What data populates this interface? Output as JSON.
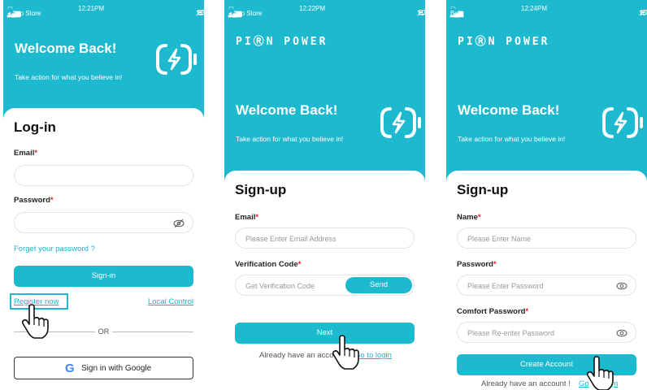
{
  "accent_color": "#1cb9cf",
  "screens": [
    {
      "status": {
        "left": "◂ App Store",
        "time": "12:21PM",
        "battery": "32%"
      },
      "welcome": "Welcome Back!",
      "tagline": "Take action for what you believe in!",
      "title": "Log-in",
      "email_label": "Email",
      "password_label": "Password",
      "forgot": "Forget your password ?",
      "signin_button": "Sign-in",
      "register": "Register now",
      "local_control": "Local Control",
      "or": "OR",
      "google_button": "Sign in with Google"
    },
    {
      "status": {
        "left": "◂ App Store",
        "time": "12:22PM",
        "battery": "31%"
      },
      "brand": "PIⓇN POWER",
      "welcome": "Welcome Back!",
      "tagline": "Take action for what you believe in!",
      "title": "Sign-up",
      "email_label": "Email",
      "email_placeholder": "Please Enter Email Address",
      "code_label": "Verification Code",
      "code_placeholder": "Get Verification Code",
      "send_button": "Send",
      "next_button": "Next",
      "already": "Already have an acco",
      "go_login": "Go to login"
    },
    {
      "status": {
        "left": "Bell",
        "time": "12:24PM",
        "battery": "30%"
      },
      "brand": "PIⓇN POWER",
      "welcome": "Welcome Back!",
      "tagline": "Take action for what you believe in!",
      "title": "Sign-up",
      "name_label": "Name",
      "name_placeholder": "Please Enter Name",
      "password_label": "Password",
      "password_placeholder": "Please Enter Password",
      "confirm_label": "Comfort Password",
      "confirm_placeholder": "Please Re-enter Password",
      "create_button": "Create Account",
      "already": "Already have an account !",
      "go_login": "Go",
      "go_login_tail": "n"
    }
  ]
}
